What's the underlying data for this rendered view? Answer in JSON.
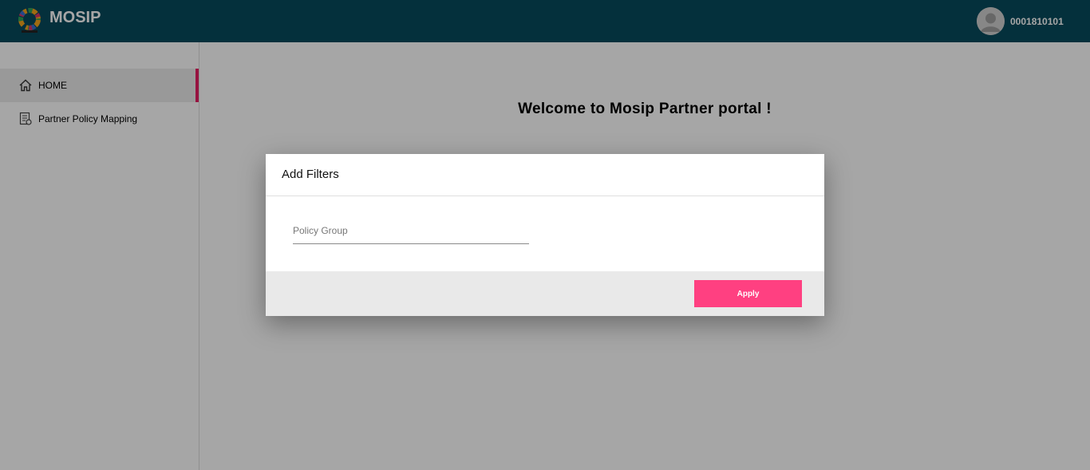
{
  "header": {
    "brand": "MOSIP",
    "user_id": "0001810101",
    "colors": {
      "bar": "#074b5c"
    }
  },
  "sidebar": {
    "items": [
      {
        "label": "HOME",
        "icon": "home-icon",
        "active": true
      },
      {
        "label": "Partner Policy Mapping",
        "icon": "policy-document-icon",
        "active": false
      }
    ],
    "active_color": "#e91e63"
  },
  "main": {
    "welcome": "Welcome to Mosip Partner portal !"
  },
  "dialog": {
    "title": "Add Filters",
    "policy_group_placeholder": "Policy Group",
    "apply_label": "Apply",
    "apply_color": "#ff4081"
  }
}
